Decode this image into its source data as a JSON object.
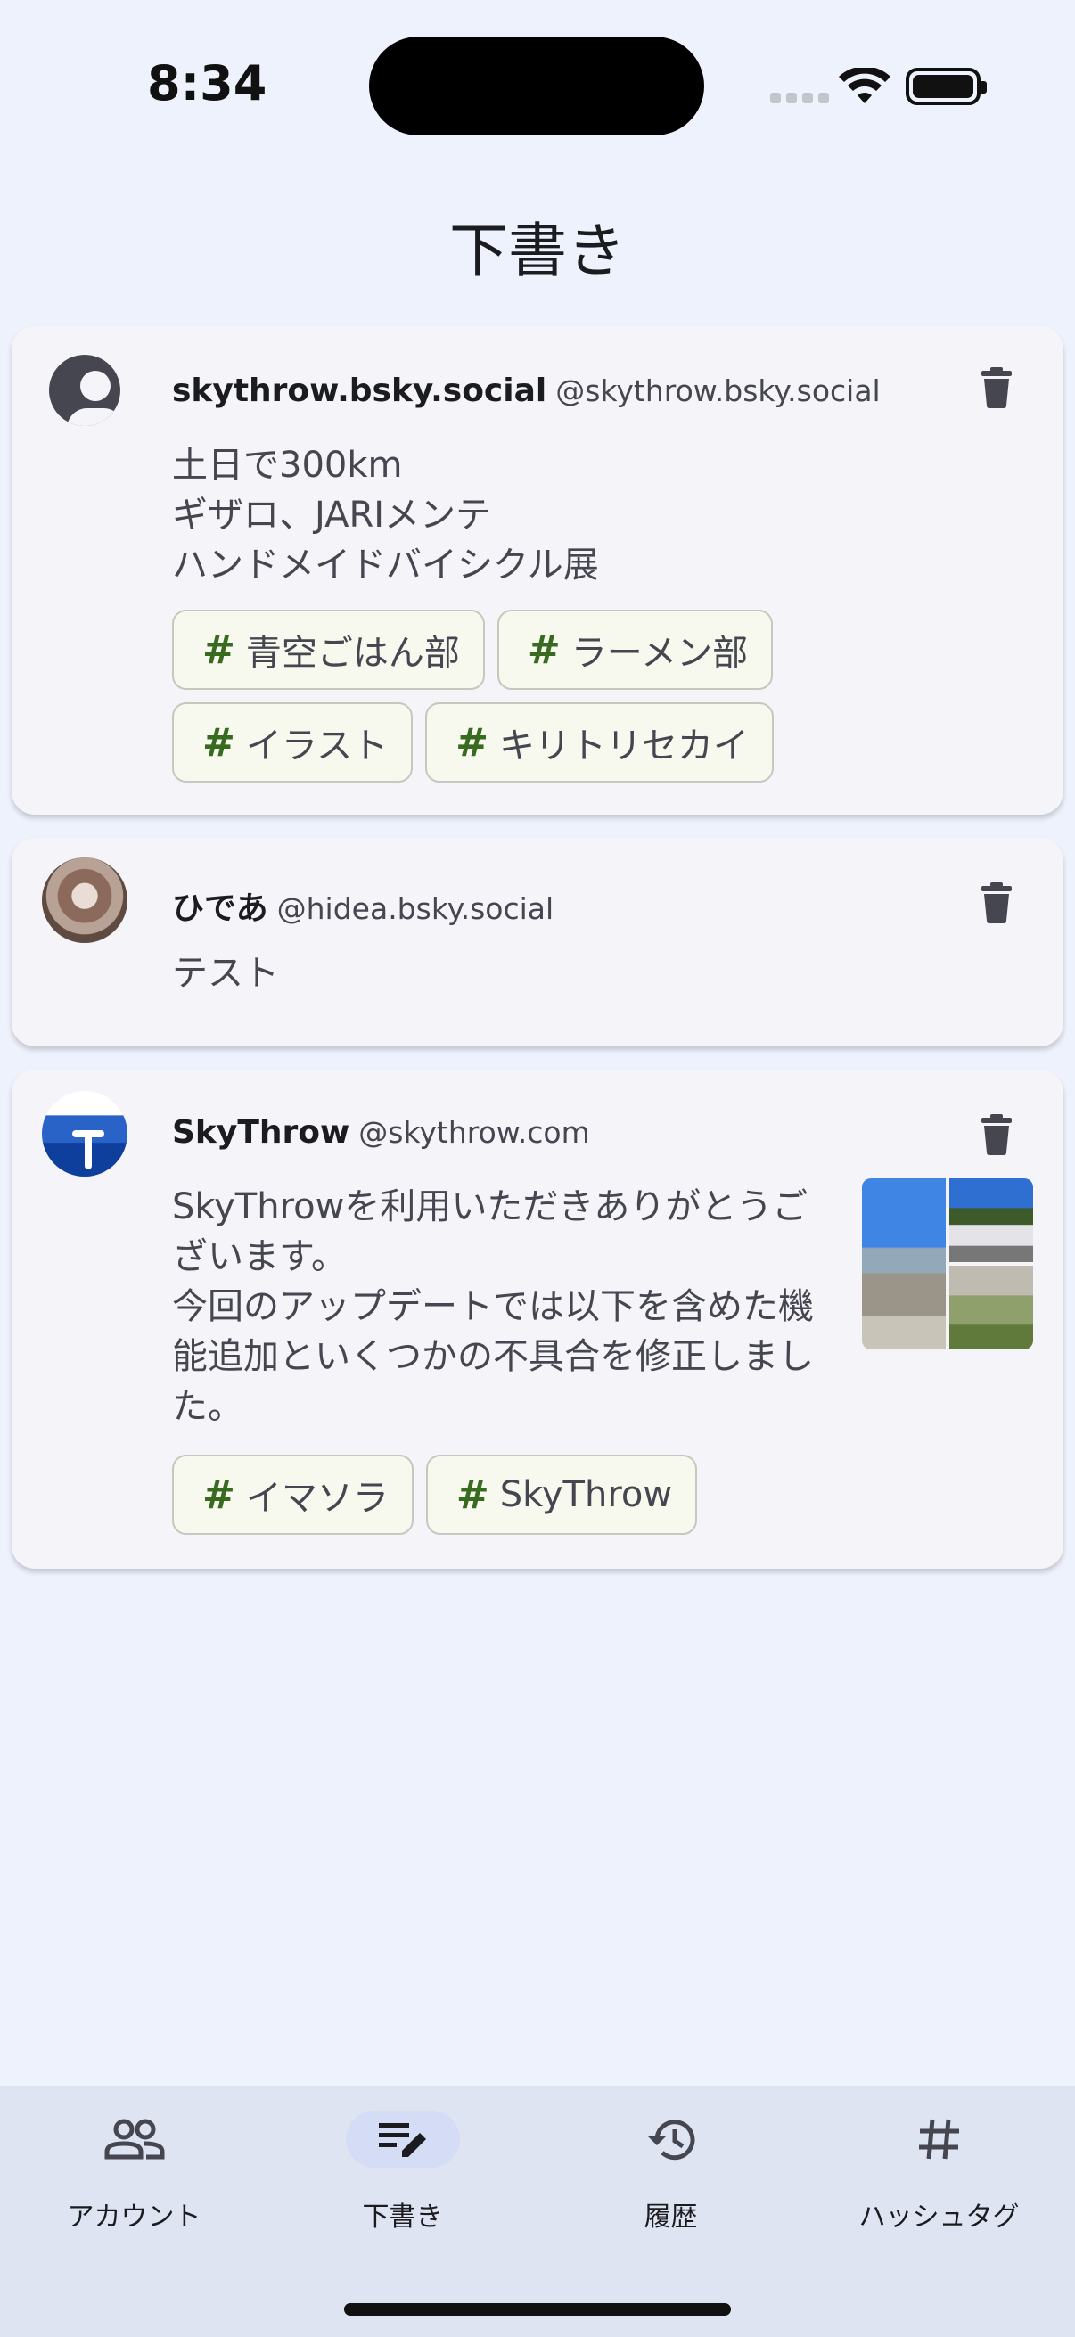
{
  "status_bar": {
    "time": "8:34"
  },
  "page_title": "下書き",
  "drafts": [
    {
      "display_name": "skythrow.bsky.social",
      "handle": "@skythrow.bsky.social",
      "text": "土日で300km\nギザロ、JARIメンテ\nハンドメイドバイシクル展",
      "tags": [
        "青空ごはん部",
        "ラーメン部",
        "イラスト",
        "キリトリセカイ"
      ]
    },
    {
      "display_name": "ひであ",
      "handle": "@hidea.bsky.social",
      "text": "テスト",
      "tags": []
    },
    {
      "display_name": "SkyThrow",
      "handle": "@skythrow.com",
      "text": "SkyThrowを利用いただきありがとうご\nざいます。\n今回のアップデートでは以下を含めた機\n能追加といくつかの不具合を修正しまし\nた。",
      "tags": [
        "イマソラ",
        "SkyThrow"
      ]
    }
  ],
  "nav": {
    "items": [
      {
        "label": "アカウント",
        "icon": "people-icon"
      },
      {
        "label": "下書き",
        "icon": "edit-note-icon",
        "active": true
      },
      {
        "label": "履歴",
        "icon": "history-icon"
      },
      {
        "label": "ハッシュタグ",
        "icon": "hashtag-icon"
      }
    ]
  },
  "colors": {
    "background": "#eef2fd",
    "card": "#f4f4f9",
    "hashtag": "#386a20",
    "nav": "#dfe4f3",
    "nav_active": "#d5dcf6"
  }
}
